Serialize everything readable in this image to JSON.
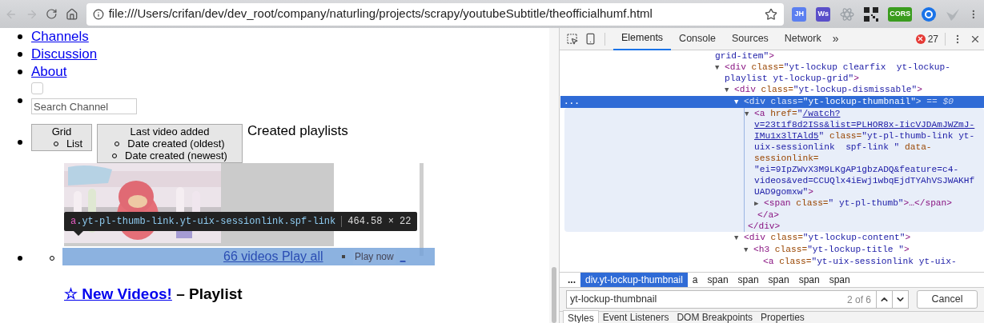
{
  "browser": {
    "address": "file:///Users/crifan/dev/dev_root/company/naturling/projects/scrapy/youtubeSubtitle/theofficialhumf.html",
    "extensions": [
      {
        "kind": "text",
        "label": "JH",
        "color": "#5b7ff0"
      },
      {
        "kind": "text",
        "label": "Ws",
        "color": "#5a4fc9"
      },
      {
        "kind": "atom",
        "color": "#9aa0a6"
      },
      {
        "kind": "qr",
        "color": "#222222"
      },
      {
        "kind": "text",
        "label": "CORS",
        "color": "#3a9c1e"
      },
      {
        "kind": "ring",
        "color": "#1a73e8"
      },
      {
        "kind": "bird",
        "color": "#b0b4b8"
      }
    ]
  },
  "page": {
    "nav_links": [
      "Channels",
      "Discussion",
      "About"
    ],
    "checkbox": {
      "checked": false
    },
    "search": {
      "placeholder": "Search Channel"
    },
    "view_button": {
      "label": "Grid",
      "items": [
        "List"
      ]
    },
    "sort_button": {
      "label": "Last video added",
      "items": [
        "Date created (oldest)",
        "Date created (newest)"
      ]
    },
    "section_title": "Created playlists",
    "tooltip": {
      "tag": "a",
      "selector": ".yt-pl-thumb-link.yt-uix-sessionlink.spf-link",
      "size": "464.58 × 22"
    },
    "playlist": {
      "count_link": "66 videos Play all",
      "play_now": "Play now",
      "trailing_link": "_",
      "title_link": "☆ New Videos!",
      "suffix": " – Playlist"
    }
  },
  "devtools": {
    "tabs": [
      {
        "label": "Elements",
        "selected": true
      },
      {
        "label": "Console",
        "selected": false
      },
      {
        "label": "Sources",
        "selected": false
      },
      {
        "label": "Network",
        "selected": false
      }
    ],
    "more": "»",
    "error_count": "27",
    "tree": [
      {
        "selected": false,
        "lines": [
          [
            {
              "kind": "val",
              "text": "grid-item\""
            },
            {
              "kind": "tag",
              "text": ">"
            }
          ]
        ],
        "children": [
          {
            "arrow": "▼",
            "selected": false,
            "lines": [
              [
                {
                  "kind": "tag",
                  "text": "<div"
                },
                {
                  "kind": "attr",
                  "text": " class="
                },
                {
                  "kind": "val",
                  "text": "\"yt-lockup clearfix  yt-lockup-"
                }
              ],
              [
                {
                  "kind": "val",
                  "text": "playlist yt-lockup-grid\""
                },
                {
                  "kind": "tag",
                  "text": ">"
                }
              ]
            ],
            "children": [
              {
                "arrow": "▼",
                "selected": false,
                "lines": [
                  [
                    {
                      "kind": "tag",
                      "text": "<div"
                    },
                    {
                      "kind": "attr",
                      "text": " class="
                    },
                    {
                      "kind": "val",
                      "text": "\"yt-lockup-dismissable\""
                    },
                    {
                      "kind": "tag",
                      "text": ">"
                    }
                  ]
                ],
                "children": [
                  {
                    "arrow": "▼",
                    "selected": true,
                    "marker": "...",
                    "lines": [
                      [
                        {
                          "kind": "tag",
                          "text": "<div"
                        },
                        {
                          "kind": "attr",
                          "text": " class="
                        },
                        {
                          "kind": "val",
                          "text": "\"yt-lockup-thumbnail\""
                        },
                        {
                          "kind": "tag",
                          "text": ">"
                        },
                        {
                          "kind": "ref",
                          "text": " == $0"
                        }
                      ]
                    ],
                    "close": "</div>",
                    "children": [
                      {
                        "arrow": "▼",
                        "selected": false,
                        "lines": [
                          [
                            {
                              "kind": "tag",
                              "text": "<a"
                            },
                            {
                              "kind": "attr",
                              "text": " href="
                            },
                            {
                              "kind": "val",
                              "text": "\""
                            },
                            {
                              "kind": "link",
                              "text": "/watch?"
                            }
                          ],
                          [
                            {
                              "kind": "link",
                              "text": "v=23t1f8d2ISs&list=PLHOR8x-IicVJDAmJWZmJ-"
                            }
                          ],
                          [
                            {
                              "kind": "link",
                              "text": "IMu1x3lTAld5"
                            },
                            {
                              "kind": "val",
                              "text": "\""
                            },
                            {
                              "kind": "attr",
                              "text": " class="
                            },
                            {
                              "kind": "val",
                              "text": "\"yt-pl-thumb-link yt-"
                            }
                          ],
                          [
                            {
                              "kind": "val",
                              "text": "uix-sessionlink  spf-link \""
                            },
                            {
                              "kind": "attr",
                              "text": " data-"
                            }
                          ],
                          [
                            {
                              "kind": "attr",
                              "text": "sessionlink="
                            }
                          ],
                          [
                            {
                              "kind": "val",
                              "text": "\"ei=9IpZWvX3M9LKgAP1gbzADQ&feature=c4-"
                            }
                          ],
                          [
                            {
                              "kind": "val",
                              "text": "videos&ved=CCUQlx4iEwj1wbqEjdTYAhVSJWAKHf"
                            }
                          ],
                          [
                            {
                              "kind": "val",
                              "text": "UAD9gomxw\""
                            },
                            {
                              "kind": "tag",
                              "text": ">"
                            }
                          ]
                        ],
                        "close": "</a>",
                        "children": [
                          {
                            "arrow": "▶",
                            "selected": false,
                            "lines": [
                              [
                                {
                                  "kind": "tag",
                                  "text": "<span"
                                },
                                {
                                  "kind": "attr",
                                  "text": " class="
                                },
                                {
                                  "kind": "val",
                                  "text": "\" yt-pl-thumb\""
                                },
                                {
                                  "kind": "tag",
                                  "text": ">…</span>"
                                }
                              ]
                            ]
                          }
                        ]
                      }
                    ]
                  },
                  {
                    "arrow": "▼",
                    "selected": false,
                    "lines": [
                      [
                        {
                          "kind": "tag",
                          "text": "<div"
                        },
                        {
                          "kind": "attr",
                          "text": " class="
                        },
                        {
                          "kind": "val",
                          "text": "\"yt-lockup-content\""
                        },
                        {
                          "kind": "tag",
                          "text": ">"
                        }
                      ]
                    ],
                    "children": [
                      {
                        "arrow": "▼",
                        "selected": false,
                        "lines": [
                          [
                            {
                              "kind": "tag",
                              "text": "<h3"
                            },
                            {
                              "kind": "attr",
                              "text": " class="
                            },
                            {
                              "kind": "val",
                              "text": "\"yt-lockup-title \""
                            },
                            {
                              "kind": "tag",
                              "text": ">"
                            }
                          ]
                        ],
                        "children": [
                          {
                            "selected": false,
                            "lines": [
                              [
                                {
                                  "kind": "tag",
                                  "text": "<a"
                                },
                                {
                                  "kind": "attr",
                                  "text": " class="
                                },
                                {
                                  "kind": "val",
                                  "text": "\"yt-uix-sessionlink yt-uix-"
                                }
                              ]
                            ]
                          }
                        ]
                      }
                    ]
                  }
                ]
              }
            ]
          }
        ]
      }
    ],
    "breadcrumbs": [
      {
        "label": "...",
        "selected": false
      },
      {
        "label": "div.yt-lockup-thumbnail",
        "selected": true
      },
      {
        "label": "a",
        "selected": false
      },
      {
        "label": "span",
        "selected": false
      },
      {
        "label": "span",
        "selected": false
      },
      {
        "label": "span",
        "selected": false
      },
      {
        "label": "span",
        "selected": false
      },
      {
        "label": "span",
        "selected": false
      }
    ],
    "find": {
      "value": "yt-lockup-thumbnail",
      "count": "2 of 6",
      "cancel": "Cancel"
    },
    "panel_tabs": [
      {
        "label": "Styles",
        "selected": true
      },
      {
        "label": "Event Listeners",
        "selected": false
      },
      {
        "label": "DOM Breakpoints",
        "selected": false
      },
      {
        "label": "Properties",
        "selected": false
      }
    ]
  }
}
